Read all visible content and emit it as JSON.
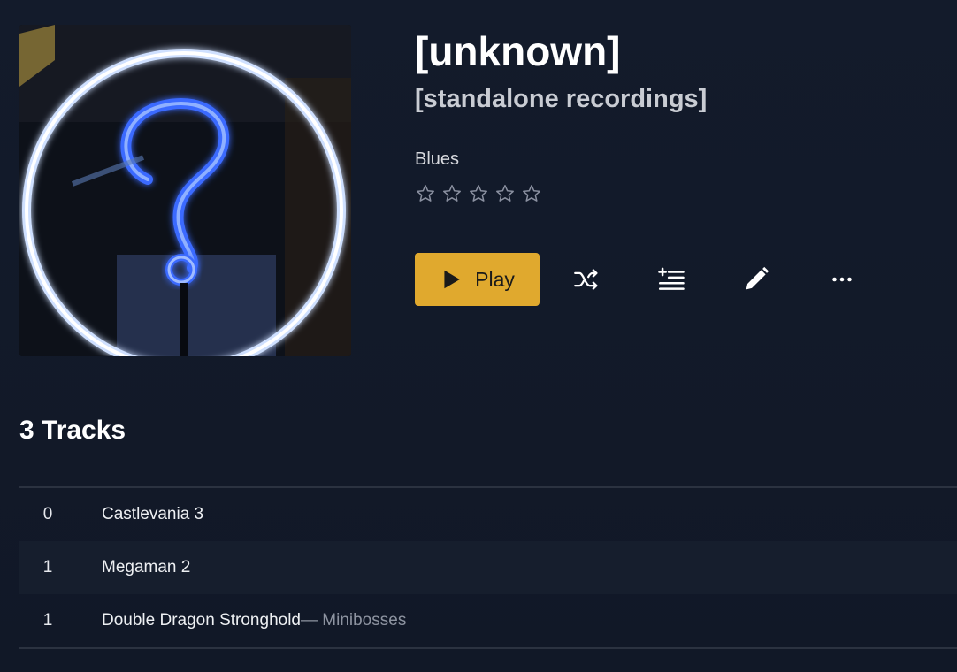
{
  "album": {
    "title": "[unknown]",
    "subtitle": "[standalone recordings]",
    "genre": "Blues",
    "rating": 0,
    "rating_max": 5
  },
  "actions": {
    "play_label": "Play",
    "shuffle_icon": "shuffle-icon",
    "queue_icon": "add-to-queue-icon",
    "edit_icon": "pencil-icon",
    "more_icon": "more-icon"
  },
  "tracks_section": {
    "heading": "3 Tracks"
  },
  "tracks": [
    {
      "number": "0",
      "title": "Castlevania 3",
      "artist_suffix": ""
    },
    {
      "number": "1",
      "title": "Megaman 2",
      "artist_suffix": ""
    },
    {
      "number": "1",
      "title": "Double Dragon Stronghold",
      "artist_suffix": " — Minibosses"
    }
  ],
  "colors": {
    "accent": "#e0a92e",
    "background": "#121a29",
    "neon_ring": "#e8f0ff",
    "neon_question": "#2f5bff"
  }
}
